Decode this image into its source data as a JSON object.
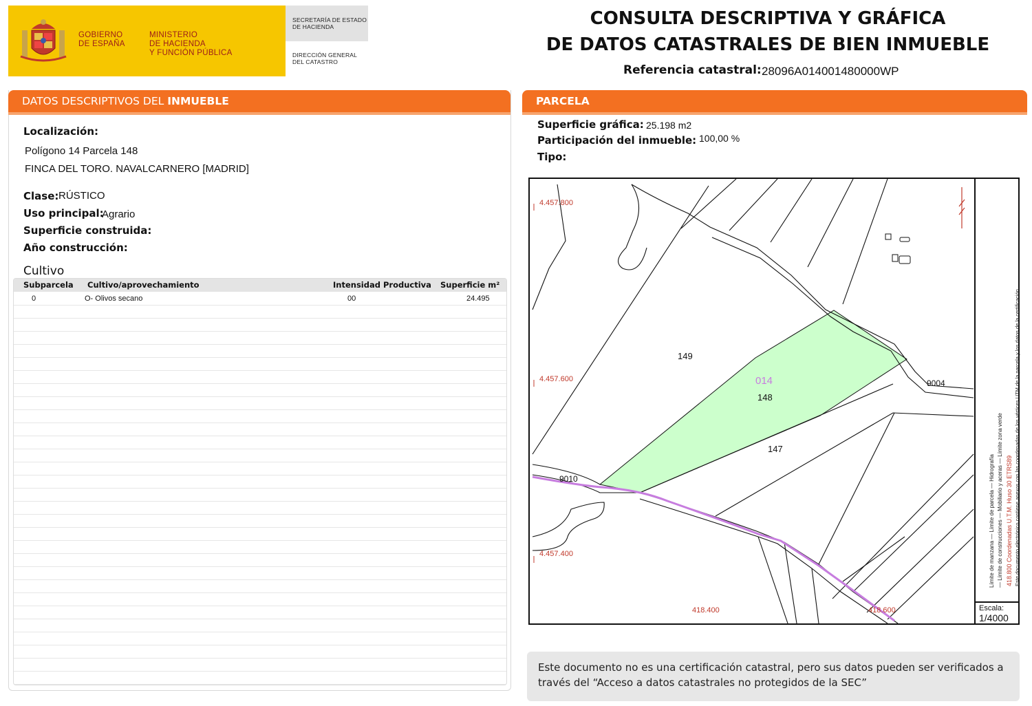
{
  "header": {
    "gobierno": "GOBIERNO\nDE ESPAÑA",
    "ministerio": "MINISTERIO\nDE HACIENDA\nY FUNCIÓN PÚBLICA",
    "secretaria": "SECRETARÍA DE ESTADO\nDE HACIENDA",
    "direccion": "DIRECCIÓN GENERAL\nDEL CATASTRO",
    "title_line1": "CONSULTA DESCRIPTIVA Y GRÁFICA",
    "title_line2": "DE DATOS CATASTRALES DE BIEN INMUEBLE",
    "ref_label": "Referencia catastral:",
    "ref_value": "28096A014001480000WP"
  },
  "colors": {
    "accent": "#f37021",
    "banner": "#f6c600",
    "parcel_fill": "#ccffcc",
    "coord_red": "#c0392b",
    "boundary_purple": "#c77ddf"
  },
  "descriptivos": {
    "section_title_a": "DATOS DESCRIPTIVOS DEL ",
    "section_title_b": "INMUEBLE",
    "localizacion_label": "Localización:",
    "localizacion_line1": "Polígono 14 Parcela 148",
    "localizacion_line2": "FINCA DEL TORO. NAVALCARNERO [MADRID]",
    "clase_label": "Clase:",
    "clase_value": "RÚSTICO",
    "uso_label": "Uso principal:",
    "uso_value": "Agrario",
    "superficie_label": "Superficie construida:",
    "anio_label": "Año construcción:",
    "cultivo_title": "Cultivo"
  },
  "cultivo_table": {
    "headers": [
      "Subparcela",
      "Cultivo/aprovechamiento",
      "Intensidad Productiva",
      "Superficie m²"
    ],
    "rows": [
      {
        "subparcela": "0",
        "cultivo": "O- Olivos secano",
        "intensidad": "00",
        "superficie": "24.495"
      }
    ]
  },
  "parcela": {
    "section_title": "PARCELA",
    "superficie_label": "Superficie gráfica:",
    "superficie_value": "25.198 m2",
    "participacion_label": "Participación del inmueble:",
    "participacion_value": "100,00 %",
    "tipo_label": "Tipo:"
  },
  "map": {
    "coord_y1": "4.457.800",
    "coord_y2": "4.457.600",
    "coord_y3": "4.457.400",
    "coord_x1": "418.400",
    "coord_x2": "418.600",
    "parcel_poligono": "014",
    "parcel_148": "148",
    "parcel_149": "149",
    "parcel_147": "147",
    "road_9004": "9004",
    "road_9010": "9010",
    "legend_text_a": "Límite de manzana   —  Límite de parcela   —  Hidrografía",
    "legend_text_b": "—  Límite de construcciones   —  Mobiliario y aceras   —  Límite zona verde",
    "legend_utm": "418.800 Coordenadas U.T.M. Huso 30 ETRS89",
    "legend_doc": "Este documento electrónico contiene anexos con las coordenadas de los vértices UTM de la parcela y los datos de la certificación.",
    "scale_label": "Escala:",
    "scale_value": "1/4000"
  },
  "footer": {
    "note": "Este documento no es una certificación catastral, pero sus datos pueden ser verificados a través del “Acceso a datos catastrales no protegidos de la SEC”"
  }
}
